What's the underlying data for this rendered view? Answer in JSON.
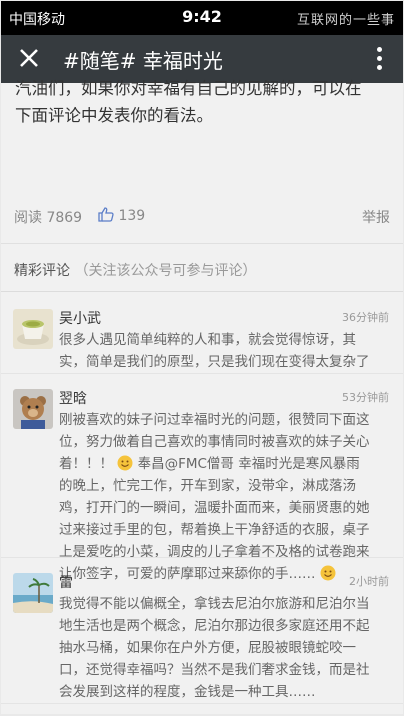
{
  "status_bar": {
    "carrier": "中国移动",
    "time": "9:42",
    "watermark": "互联网的一些事"
  },
  "nav": {
    "title": "#随笔# 幸福时光"
  },
  "article": {
    "lines": [
      "汽油们，如果你对幸福有自己的见解的，可以在",
      "下面评论中发表你的看法。"
    ]
  },
  "stats": {
    "read_label": "阅读 7869",
    "likes": "139",
    "report_label": "举报"
  },
  "comments_section": {
    "title": "精彩评论",
    "hint": "（关注该公众号可参与评论）"
  },
  "comments": [
    {
      "name": "吴小武",
      "time": "36分钟前",
      "lines": [
        "很多人遇见简单纯粹的人和事，就会觉得惊讶，其",
        "实，简单是我们的原型，只是我们现在变得太复杂了"
      ]
    },
    {
      "name": "翌晗",
      "time": "53分钟前",
      "lines": [
        "刚被喜欢的妹子问过幸福时光的问题，很赞同下面这",
        "位，努力做着自己喜欢的事情同时被喜欢的妹子关心",
        "着！！！",
        "奉昌@FMC僧哥 幸福时光是寒风暴雨",
        "的晚上，忙完工作，开车到家，没带伞，淋成落汤",
        "鸡，打开门的一瞬间，温暖扑面而来，美丽贤惠的她",
        "过来接过手里的包，帮着换上干净舒适的衣服，桌子",
        "上是爱吃的小菜，调皮的儿子拿着不及格的试卷跑来",
        "让你签字，可爱的萨摩耶过来舔你的手……"
      ]
    },
    {
      "name": "雷",
      "time": "2小时前",
      "lines": [
        "我觉得不能以偏概全，拿钱去尼泊尔旅游和尼泊尔当",
        "地生活也是两个概念，尼泊尔那边很多家庭还用不起",
        "抽水马桶，如果你在户外方便，屁股被眼镜蛇咬一",
        "口，还觉得幸福吗？当然不是我们奢求金钱，而是社",
        "会发展到这样的程度，金钱是一种工具……"
      ]
    }
  ],
  "colors": {
    "navbar_bg": "#363b3f",
    "like_icon": "#5b7ec8"
  }
}
